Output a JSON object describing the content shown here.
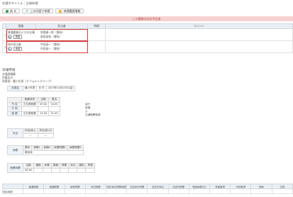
{
  "page": {
    "title": "交通ボタイトル｜日報申請"
  },
  "toolbar": {
    "back_label": "戻 る",
    "submit_label": "この内容で申請",
    "history_label": "申請履歴情報"
  },
  "history": {
    "banner": "この書類の対応予定者",
    "headers": {
      "route": "経路",
      "approver": "担当者",
      "time": "時期",
      "comment": "コメント"
    },
    "rows": [
      {
        "num": "1",
        "route_title": "普通勤務およびお仕事",
        "status": "承認",
        "approvers": [
          "申請者一郎（課長）",
          "部長部長（課長）"
        ]
      },
      {
        "num": "2",
        "route_title": "他の担当者",
        "status": "承認",
        "approvers": [
          "中田英一（課長）",
          "中田英一（課長）"
        ]
      }
    ]
  },
  "report": {
    "title": "日報申請",
    "meta": [
      "交通費精算",
      "作業区分",
      "所属部：最小先男（デフォルトグループ）"
    ],
    "applicant": {
      "label": "社員名",
      "name": "最小先男",
      "day": "日 付",
      "date": "2025年10月03日(金)"
    },
    "time_table": {
      "headers": [
        "",
        "勤務体系",
        "出勤",
        "退出"
      ],
      "rows": [
        [
          "予 定",
          "正社員勤務",
          "09:00",
          "18:00"
        ],
        [
          "打 刻",
          "-",
          "",
          ""
        ],
        [
          "実 績",
          "正社員勤務",
          "14:00",
          "21:00"
        ]
      ]
    },
    "side_notes": [
      "曲行",
      "普通",
      "公",
      "交通機関勤務"
    ],
    "outing": {
      "label": "外出",
      "col1": "外出/戻入",
      "col2": "外出/戻入2",
      "v1": "—",
      "v2": "—"
    },
    "breaks": {
      "label": "休憩",
      "cols": [
        "基本",
        "休憩1",
        "休憩2",
        "休憩時間1",
        "休憩時間2"
      ],
      "values": [
        "",
        "",
        "",
        "",
        ""
      ],
      "sub": "朝出休"
    },
    "work_time": {
      "label": "就業時間",
      "cols": [
        "出勤",
        "通勤",
        "休憩",
        "実働",
        "残業",
        "休日",
        "遅刻",
        "早退"
      ],
      "values": [
        "08:00",
        "",
        "",
        "",
        "",
        "",
        "",
        ""
      ]
    },
    "bottom_headers": [
      "",
      "普通勤務",
      "普通残業",
      "深夜残業",
      "休日残業",
      "特定休日残業時間",
      "法定休日残業",
      "法定外休日",
      "法定内残業",
      "有給休暇(日)",
      "有給取得",
      "代休取得",
      "振休",
      "欠勤"
    ],
    "bottom_row_label": "勤怠時間"
  }
}
